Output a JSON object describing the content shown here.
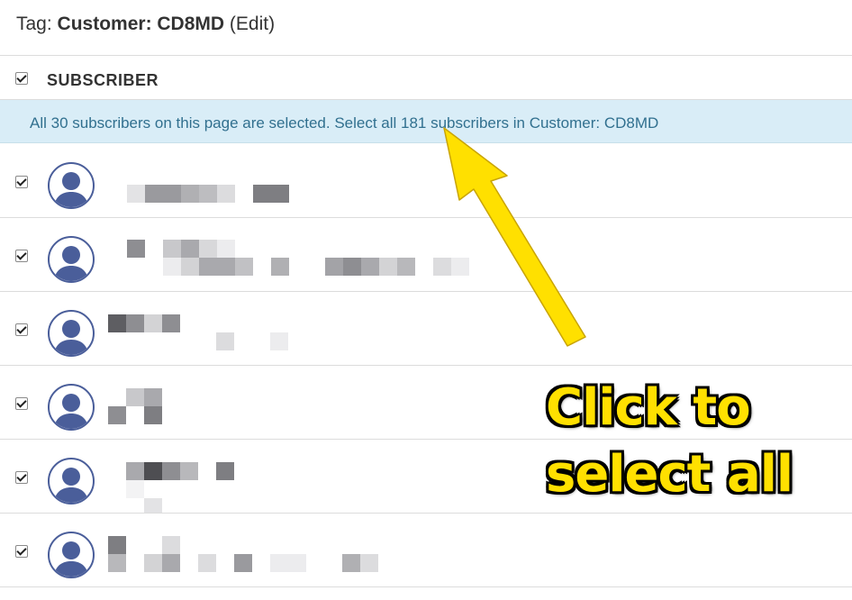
{
  "header": {
    "prefix": "Tag:",
    "tag_name": "Customer: CD8MD",
    "edit_label": "(Edit)"
  },
  "table": {
    "column_label": "SUBSCRIBER",
    "select_all_checked": true
  },
  "banner": {
    "message": "All 30 subscribers on this page are selected.",
    "link_label": "Select all 181 subscribers in Customer: CD8MD"
  },
  "rows": [
    {
      "checked": true,
      "name": "",
      "email": ""
    },
    {
      "checked": true,
      "name": "",
      "email": ""
    },
    {
      "checked": true,
      "name": "",
      "email": ""
    },
    {
      "checked": true,
      "name": "",
      "email": ""
    },
    {
      "checked": true,
      "name": "",
      "email": ""
    },
    {
      "checked": true,
      "name": "",
      "email": ""
    }
  ],
  "annotation": {
    "line1": "Click to",
    "line2": "select all"
  },
  "colors": {
    "banner_bg": "#d9edf7",
    "banner_text": "#31708f",
    "avatar": "#4a5e9a",
    "arrow": "#ffe000",
    "callout_text": "#ffe000"
  },
  "icons": {
    "avatar": "person-silhouette-icon",
    "checkbox": "checkbox-checked-icon"
  }
}
